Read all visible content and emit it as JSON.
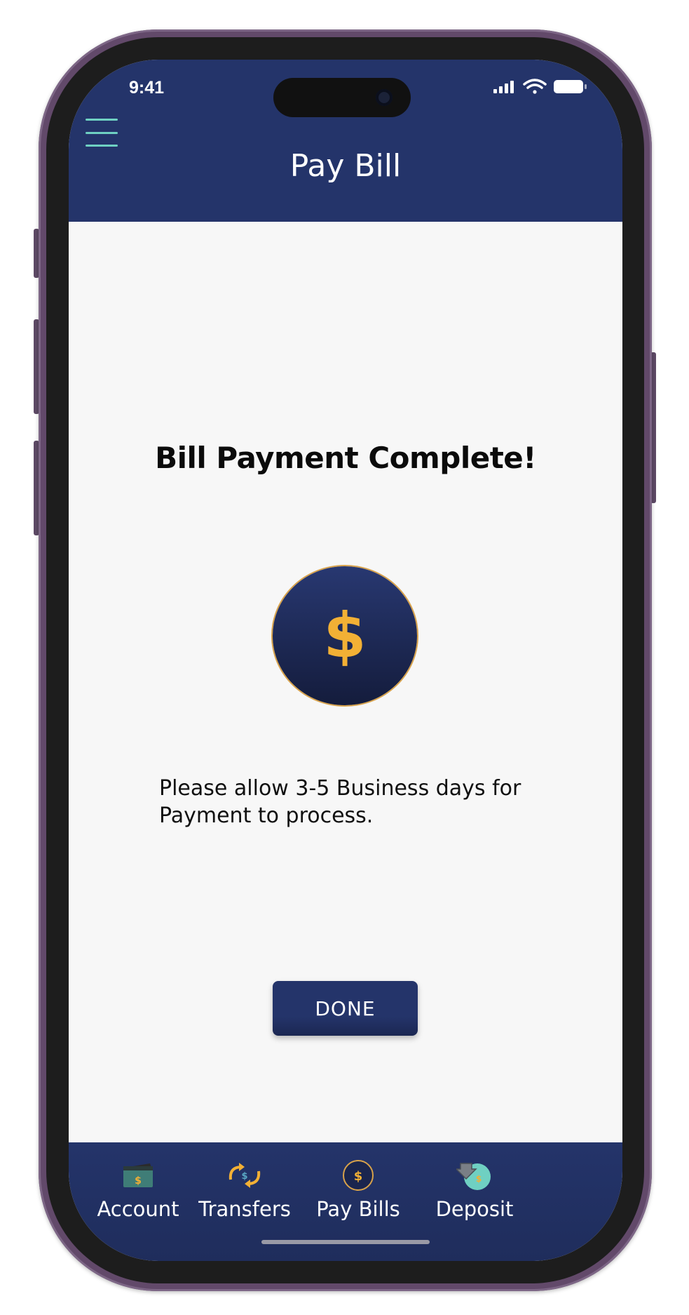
{
  "status_bar": {
    "time": "9:41"
  },
  "header": {
    "title": "Pay Bill",
    "menu_icon": "hamburger-menu-icon"
  },
  "content": {
    "heading": "Bill Payment Complete!",
    "badge_symbol": "$",
    "note_line1": "Please allow 3-5 Business days for",
    "note_line2": "Payment to process.",
    "done_label": "DONE"
  },
  "tabbar": {
    "items": [
      {
        "label": "Account",
        "icon": "wallet-icon"
      },
      {
        "label": "Transfers",
        "icon": "transfer-arrows-icon"
      },
      {
        "label": "Pay Bills",
        "icon": "dollar-coin-icon"
      },
      {
        "label": "Deposit",
        "icon": "deposit-icon"
      }
    ]
  },
  "colors": {
    "header": "#24346a",
    "accent_gold": "#f2b035",
    "accent_teal": "#6fd0c2",
    "background": "#f7f7f7"
  }
}
